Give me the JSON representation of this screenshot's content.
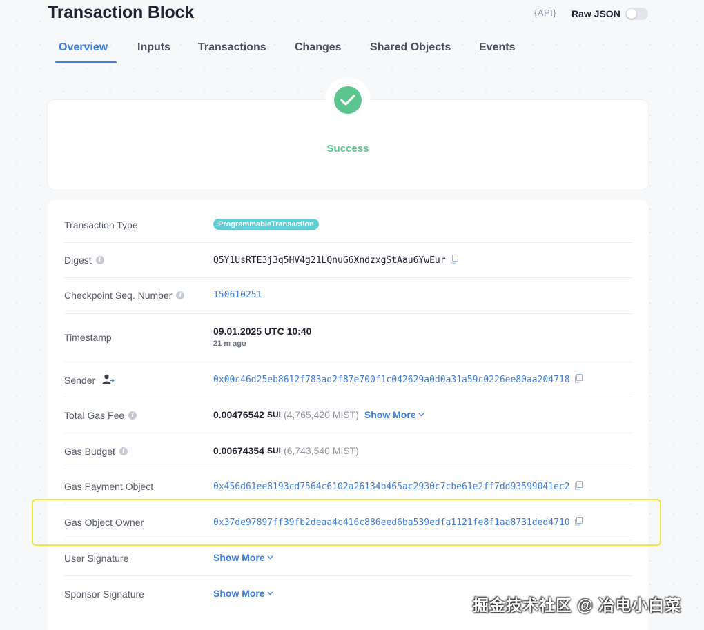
{
  "header": {
    "title": "Transaction Block",
    "api_label": "{API}",
    "raw_json_label": "Raw JSON",
    "raw_json_enabled": false
  },
  "tabs": [
    {
      "label": "Overview",
      "active": true
    },
    {
      "label": "Inputs"
    },
    {
      "label": "Transactions"
    },
    {
      "label": "Changes"
    },
    {
      "label": "Shared Objects"
    },
    {
      "label": "Events"
    }
  ],
  "status": {
    "text": "Success",
    "color": "#5cc58f",
    "icon": "check-circle-icon"
  },
  "details": {
    "transaction_type": {
      "label": "Transaction Type",
      "value": "ProgrammableTransaction"
    },
    "digest": {
      "label": "Digest",
      "value": "Q5Y1UsRTE3j3q5HV4g21LQnuG6XndzxgStAau6YwEur"
    },
    "checkpoint": {
      "label": "Checkpoint Seq. Number",
      "value": "150610251"
    },
    "timestamp": {
      "label": "Timestamp",
      "value": "09.01.2025 UTC 10:40",
      "relative": "21 m ago"
    },
    "sender": {
      "label": "Sender",
      "value": "0x00c46d25eb8612f783ad2f87e700f1c042629a0d0a31a59c0226ee80aa204718"
    },
    "total_gas_fee": {
      "label": "Total Gas Fee",
      "value": "0.00476542",
      "unit": "SUI",
      "mist": "(4,765,420 MIST)",
      "show_more": "Show More"
    },
    "gas_budget": {
      "label": "Gas Budget",
      "value": "0.00674354",
      "unit": "SUI",
      "mist": "(6,743,540 MIST)"
    },
    "gas_payment_object": {
      "label": "Gas Payment Object",
      "value": "0x456d61ee8193cd7564c6102a26134b465ac2930c7cbe61e2ff7dd93599041ec2"
    },
    "gas_object_owner": {
      "label": "Gas Object Owner",
      "value": "0x37de97897ff39fb2deaa4c416c886eed6ba539edfa1121fe8f1aa8731ded4710"
    },
    "user_signature": {
      "label": "User Signature",
      "show_more": "Show More"
    },
    "sponsor_signature": {
      "label": "Sponsor Signature",
      "show_more": "Show More"
    }
  },
  "colors": {
    "accent": "#3c7de0",
    "success": "#5cc58f",
    "pill": "#5ccfd6",
    "highlight": "#f0e444"
  },
  "watermark": "掘金技术社区 @ 冶电小白菜"
}
